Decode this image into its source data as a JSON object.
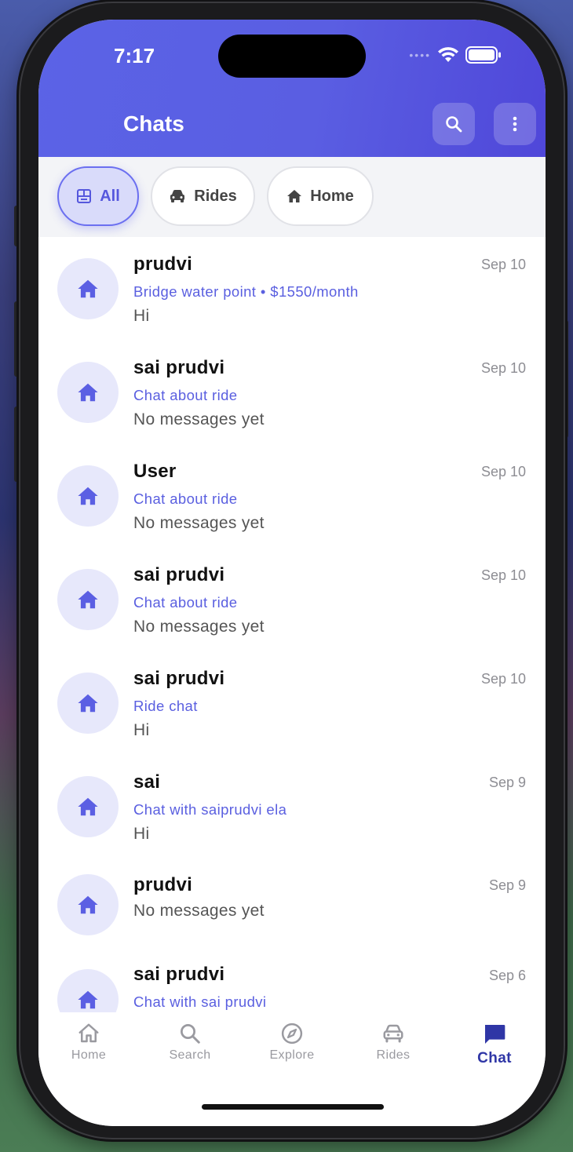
{
  "status_bar": {
    "time": "7:17"
  },
  "header": {
    "title": "Chats"
  },
  "filters": [
    {
      "label": "All",
      "icon": "grid-icon",
      "active": true
    },
    {
      "label": "Rides",
      "icon": "car-icon",
      "active": false
    },
    {
      "label": "Home",
      "icon": "home-icon",
      "active": false
    }
  ],
  "chats": [
    {
      "name": "prudvi",
      "subtitle": "Bridge water point • $1550/month",
      "message": "Hi",
      "date": "Sep 10"
    },
    {
      "name": "sai prudvi",
      "subtitle": "Chat about ride",
      "message": "No messages yet",
      "date": "Sep 10"
    },
    {
      "name": "User",
      "subtitle": "Chat about ride",
      "message": "No messages yet",
      "date": "Sep 10"
    },
    {
      "name": "sai prudvi",
      "subtitle": "Chat about ride",
      "message": "No messages yet",
      "date": "Sep 10"
    },
    {
      "name": "sai prudvi",
      "subtitle": "Ride chat",
      "message": "Hi",
      "date": "Sep 10"
    },
    {
      "name": "sai",
      "subtitle": "Chat with saiprudvi ela",
      "message": "Hi",
      "date": "Sep 9"
    },
    {
      "name": "prudvi",
      "subtitle": "",
      "message": "No messages yet",
      "date": "Sep 9"
    },
    {
      "name": "sai prudvi",
      "subtitle": "Chat with sai prudvi",
      "message": "",
      "date": "Sep 6"
    }
  ],
  "tabs": [
    {
      "label": "Home",
      "icon": "home-outline-icon"
    },
    {
      "label": "Search",
      "icon": "search-icon"
    },
    {
      "label": "Explore",
      "icon": "compass-icon"
    },
    {
      "label": "Rides",
      "icon": "car-outline-icon"
    },
    {
      "label": "Chat",
      "icon": "chat-bubble-icon",
      "active": true
    }
  ],
  "colors": {
    "accent": "#5b5fe3",
    "active_tab": "#2f36a6",
    "avatar_bg": "#e7e8fb"
  }
}
